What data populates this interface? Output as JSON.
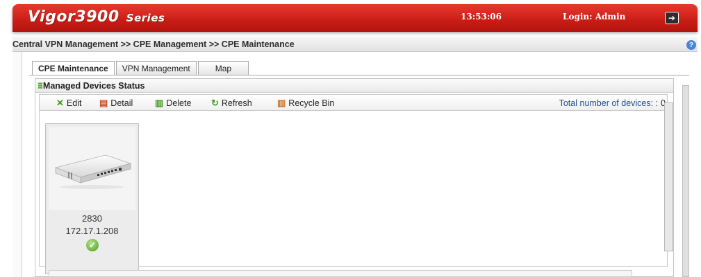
{
  "header": {
    "brand": "Vigor3900",
    "series": "Series",
    "time": "13:53:06",
    "login": "Login: Admin"
  },
  "breadcrumb": "Central VPN Management >> CPE Management >> CPE Maintenance",
  "tabs": [
    {
      "label": "CPE Maintenance",
      "active": true
    },
    {
      "label": "VPN Management",
      "active": false
    },
    {
      "label": "Map",
      "active": false
    }
  ],
  "panel": {
    "title": "Managed Devices Status"
  },
  "toolbar": {
    "edit": "Edit",
    "detail": "Detail",
    "delete": "Delete",
    "refresh": "Refresh",
    "recycle_bin": "Recycle Bin",
    "total_label": "Total number of devices: :",
    "total_count": "0"
  },
  "devices": [
    {
      "model": "2830",
      "ip": "172.17.1.208",
      "status": "online"
    }
  ],
  "colors": {
    "header_red": "#c81d16",
    "link_blue": "#1f4e8c",
    "icon_green": "#4c9a2a"
  }
}
